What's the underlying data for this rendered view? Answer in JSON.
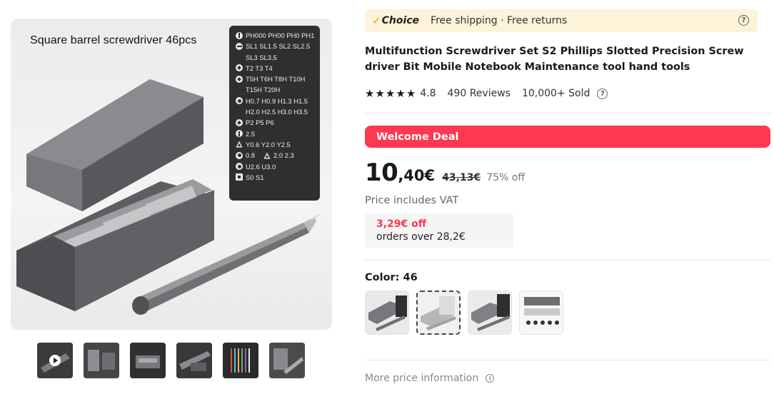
{
  "gallery": {
    "caption": "Square barrel screwdriver 46pcs",
    "bit_list": [
      {
        "icon": "ph",
        "text": "PH000 PH00 PH0 PH1"
      },
      {
        "icon": "sl",
        "text": "SL1 SL1.5 SL2 SL2.5"
      },
      {
        "icon": "none",
        "text": "SL3 SL3.5"
      },
      {
        "icon": "star",
        "text": "T2 T3 T4"
      },
      {
        "icon": "star",
        "text": "T5H T6H T8H T10H"
      },
      {
        "icon": "none",
        "text": "T15H T20H"
      },
      {
        "icon": "hex",
        "text": "H0.7 H0.9 H1.3 H1.5"
      },
      {
        "icon": "none",
        "text": "H2.0 H2.5  H3.0 H3.5"
      },
      {
        "icon": "star",
        "text": "P2 P5 P6"
      },
      {
        "icon": "ph",
        "text": "2.5"
      },
      {
        "icon": "tri",
        "text": "Y0.6 Y2.0 Y2.5"
      },
      {
        "icon": "hex",
        "text": "0.8",
        "extra_icon": "tri",
        "extra_text": "2.0  2.3"
      },
      {
        "icon": "hex",
        "text": "U2.6 U3.0"
      },
      {
        "icon": "sq",
        "text": "S0 S1"
      }
    ],
    "thumbnails": [
      {
        "name": "video",
        "icon": "play-icon"
      },
      {
        "name": "image-2"
      },
      {
        "name": "image-3"
      },
      {
        "name": "image-4"
      },
      {
        "name": "image-5"
      },
      {
        "name": "image-6"
      }
    ]
  },
  "choice": {
    "check": "✓",
    "label": "Choice",
    "text": "Free shipping · Free returns",
    "help": "?"
  },
  "product": {
    "title": "Multifunction Screwdriver Set S2 Phillips Slotted Precision Screw driver Bit Mobile Notebook Maintenance tool hand tools"
  },
  "rating": {
    "stars": 5,
    "score": "4.8",
    "reviews": "490 Reviews",
    "sold": "10,000+ Sold",
    "help": "?"
  },
  "deal": {
    "label": "Welcome Deal"
  },
  "price": {
    "integer": "10",
    "decimal": ",40€",
    "original": "43,13€",
    "discount": "75% off",
    "vat": "Price includes VAT"
  },
  "coupon": {
    "amount": "3,29€ off",
    "condition": "orders over 28,2€"
  },
  "color": {
    "label": "Color: 46",
    "options_count": 4,
    "selected_index": 1
  },
  "more_price": {
    "label": "More price information",
    "icon": "i"
  },
  "colors": {
    "deal_red": "#fd384f",
    "choice_bg": "#fdf3d8",
    "choice_check": "#f0a300"
  }
}
